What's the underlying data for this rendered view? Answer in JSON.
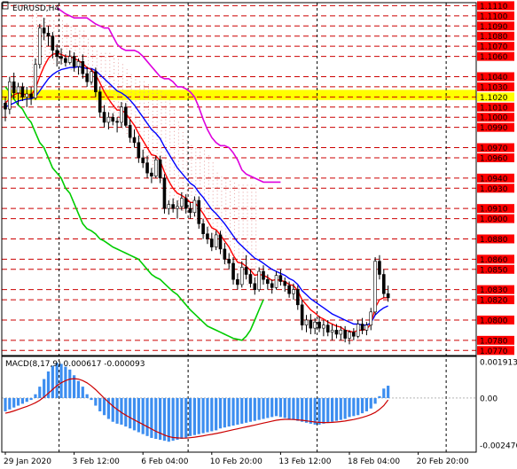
{
  "header": {
    "symbol": "EURUSD,H4",
    "macd_label": "MACD(8,17,9) 0.000617 -0.000093"
  },
  "colors": {
    "candle": "#000000",
    "fast_ma": "#ff0000",
    "slow_ma": "#0000ff",
    "trend_line": "#00cc00",
    "cloud_upper_line": "#dd00dd",
    "hline": "#cc0000",
    "highlight_band": "#ffff00",
    "highlight_tag": "#ffff00",
    "macd_hist": "#3d8ef0",
    "macd_signal": "#cc0000",
    "price_tag": "#ff0000",
    "band_lines": "#00cccc",
    "cloud_dots": "#e8a0a0"
  },
  "chart_data": [
    {
      "type": "candlestick",
      "title": "EURUSD,H4",
      "ylim": [
        1.0765,
        1.1113
      ],
      "price_levels": [
        "1.1110",
        "1.1100",
        "1.1090",
        "1.1080",
        "1.1070",
        "1.1060",
        "1.1040",
        "1.1030",
        "1.1020",
        "1.1010",
        "1.1000",
        "1.0990",
        "1.0970",
        "1.0960",
        "1.0940",
        "1.0930",
        "1.0910",
        "1.0900",
        "1.0880",
        "1.0860",
        "1.0850",
        "1.0830",
        "1.0820",
        "1.0800",
        "1.0780",
        "1.0770"
      ],
      "highlight_levels": [
        "1.1020"
      ],
      "highlight_band": [
        1.1017,
        1.1027
      ],
      "x_labels": [
        "29 Jan 2020",
        "3 Feb 12:00",
        "6 Feb 04:00",
        "10 Feb 20:00",
        "13 Feb 12:00",
        "18 Feb 04:00",
        "20 Feb 20:00"
      ],
      "x_label_index": [
        0,
        16,
        32,
        48,
        64,
        80,
        96
      ],
      "vlines_index": [
        12.5,
        42.5,
        72.5,
        102.5
      ],
      "candles_ohlc": [
        [
          1.1014,
          1.102,
          1.0996,
          1.1008
        ],
        [
          1.1008,
          1.104,
          1.1003,
          1.1035
        ],
        [
          1.1035,
          1.1044,
          1.1018,
          1.1024
        ],
        [
          1.1024,
          1.1034,
          1.1012,
          1.103
        ],
        [
          1.103,
          1.1034,
          1.1016,
          1.102
        ],
        [
          1.102,
          1.103,
          1.101,
          1.1023
        ],
        [
          1.1023,
          1.103,
          1.1012,
          1.1019
        ],
        [
          1.1019,
          1.1058,
          1.1017,
          1.1052
        ],
        [
          1.1052,
          1.1092,
          1.1048,
          1.1088
        ],
        [
          1.1088,
          1.1098,
          1.1076,
          1.1083
        ],
        [
          1.1083,
          1.109,
          1.107,
          1.108
        ],
        [
          1.108,
          1.1084,
          1.1058,
          1.1066
        ],
        [
          1.1066,
          1.1072,
          1.105,
          1.106
        ],
        [
          1.106,
          1.1068,
          1.1052,
          1.1058
        ],
        [
          1.1058,
          1.1062,
          1.105,
          1.1054
        ],
        [
          1.1054,
          1.1066,
          1.1052,
          1.106
        ],
        [
          1.106,
          1.1064,
          1.1045,
          1.105
        ],
        [
          1.105,
          1.1058,
          1.1042,
          1.1055
        ],
        [
          1.1055,
          1.1062,
          1.1038,
          1.1043
        ],
        [
          1.1043,
          1.105,
          1.103,
          1.1035
        ],
        [
          1.1035,
          1.1048,
          1.1032,
          1.1045
        ],
        [
          1.1045,
          1.1049,
          1.102,
          1.1025
        ],
        [
          1.1025,
          1.103,
          1.1,
          1.1005
        ],
        [
          1.1005,
          1.1012,
          1.099,
          1.0995
        ],
        [
          1.0995,
          1.1005,
          1.0988,
          1.1
        ],
        [
          1.1,
          1.1004,
          1.0992,
          1.0996
        ],
        [
          1.0996,
          1.1,
          1.0985,
          1.0995
        ],
        [
          1.0995,
          1.1015,
          1.099,
          1.101
        ],
        [
          1.101,
          1.1014,
          1.099,
          1.0992
        ],
        [
          1.0992,
          1.0998,
          1.0975,
          1.098
        ],
        [
          1.098,
          1.0988,
          1.097,
          1.0975
        ],
        [
          1.0975,
          1.0982,
          1.0955,
          1.096
        ],
        [
          1.096,
          1.0968,
          1.095,
          1.0955
        ],
        [
          1.0955,
          1.0962,
          1.094,
          1.0945
        ],
        [
          1.0945,
          1.095,
          1.0935,
          1.0942
        ],
        [
          1.0942,
          1.0962,
          1.094,
          1.0958
        ],
        [
          1.0958,
          1.0962,
          1.0935,
          1.094
        ],
        [
          1.094,
          1.0944,
          1.0905,
          1.091
        ],
        [
          1.091,
          1.0918,
          1.0904,
          1.0914
        ],
        [
          1.0914,
          1.092,
          1.0906,
          1.091
        ],
        [
          1.091,
          1.0918,
          1.09,
          1.0912
        ],
        [
          1.0912,
          1.0926,
          1.0908,
          1.092
        ],
        [
          1.092,
          1.0924,
          1.0905,
          1.091
        ],
        [
          1.091,
          1.0916,
          1.09,
          1.0906
        ],
        [
          1.0906,
          1.0922,
          1.0902,
          1.0918
        ],
        [
          1.0918,
          1.0922,
          1.089,
          1.0895
        ],
        [
          1.0895,
          1.09,
          1.088,
          1.0885
        ],
        [
          1.0885,
          1.0892,
          1.0875,
          1.088
        ],
        [
          1.088,
          1.0886,
          1.0868,
          1.0872
        ],
        [
          1.0872,
          1.0888,
          1.0869,
          1.0884
        ],
        [
          1.0884,
          1.0888,
          1.0865,
          1.087
        ],
        [
          1.087,
          1.0876,
          1.0855,
          1.086
        ],
        [
          1.086,
          1.0866,
          1.085,
          1.0856
        ],
        [
          1.0856,
          1.0862,
          1.0835,
          1.084
        ],
        [
          1.084,
          1.0846,
          1.083,
          1.0835
        ],
        [
          1.0835,
          1.0858,
          1.0832,
          1.0852
        ],
        [
          1.0852,
          1.0864,
          1.084,
          1.0845
        ],
        [
          1.0845,
          1.085,
          1.0832,
          1.0836
        ],
        [
          1.0836,
          1.0842,
          1.0825,
          1.083
        ],
        [
          1.083,
          1.0852,
          1.0828,
          1.0848
        ],
        [
          1.0848,
          1.0854,
          1.0835,
          1.084
        ],
        [
          1.084,
          1.0845,
          1.083,
          1.0836
        ],
        [
          1.0836,
          1.084,
          1.0826,
          1.0832
        ],
        [
          1.0832,
          1.0848,
          1.083,
          1.0844
        ],
        [
          1.0844,
          1.085,
          1.0834,
          1.0838
        ],
        [
          1.0838,
          1.0842,
          1.0828,
          1.0834
        ],
        [
          1.0834,
          1.0838,
          1.0822,
          1.0826
        ],
        [
          1.0826,
          1.0836,
          1.082,
          1.083
        ],
        [
          1.083,
          1.0834,
          1.081,
          1.0815
        ],
        [
          1.0815,
          1.082,
          1.079,
          1.0795
        ],
        [
          1.0795,
          1.0805,
          1.0788,
          1.08
        ],
        [
          1.08,
          1.0806,
          1.0786,
          1.0792
        ],
        [
          1.0792,
          1.0802,
          1.0786,
          1.0798
        ],
        [
          1.0798,
          1.0804,
          1.0788,
          1.0792
        ],
        [
          1.0792,
          1.08,
          1.0784,
          1.0795
        ],
        [
          1.0795,
          1.08,
          1.0784,
          1.0788
        ],
        [
          1.0788,
          1.0796,
          1.078,
          1.079
        ],
        [
          1.079,
          1.0796,
          1.0782,
          1.0786
        ],
        [
          1.0786,
          1.0794,
          1.078,
          1.079
        ],
        [
          1.079,
          1.0794,
          1.0778,
          1.0782
        ],
        [
          1.0782,
          1.079,
          1.0776,
          1.0788
        ],
        [
          1.0788,
          1.0792,
          1.078,
          1.0784
        ],
        [
          1.0784,
          1.08,
          1.0782,
          1.0796
        ],
        [
          1.0796,
          1.0802,
          1.0786,
          1.079
        ],
        [
          1.079,
          1.0798,
          1.0785,
          1.0795
        ],
        [
          1.0795,
          1.0812,
          1.079,
          1.0808
        ],
        [
          1.0808,
          1.0862,
          1.0805,
          1.0858
        ],
        [
          1.0858,
          1.0864,
          1.084,
          1.0845
        ],
        [
          1.0845,
          1.085,
          1.0822,
          1.0826
        ],
        [
          1.0826,
          1.0834,
          1.0818,
          1.0822
        ]
      ],
      "fast_ma": [
        1.1014,
        1.1018,
        1.1022,
        1.1024,
        1.1023,
        1.1022,
        1.1022,
        1.1028,
        1.104,
        1.105,
        1.1058,
        1.1062,
        1.1063,
        1.1062,
        1.106,
        1.106,
        1.1058,
        1.1056,
        1.1053,
        1.1049,
        1.1047,
        1.1042,
        1.1034,
        1.1025,
        1.1018,
        1.1012,
        1.1007,
        1.1007,
        1.1004,
        1.0998,
        1.0992,
        1.0984,
        1.0977,
        1.097,
        1.0963,
        1.0962,
        1.0957,
        1.0946,
        1.0937,
        1.093,
        1.0925,
        1.0923,
        1.092,
        1.0916,
        1.0916,
        1.0911,
        1.0905,
        1.0898,
        1.0891,
        1.0889,
        1.0884,
        1.0878,
        1.0872,
        1.0864,
        1.0857,
        1.0856,
        1.0853,
        1.0849,
        1.0844,
        1.0845,
        1.0844,
        1.0842,
        1.0839,
        1.084,
        1.0839,
        1.0838,
        1.0835,
        1.0834,
        1.0829,
        1.082,
        1.0815,
        1.081,
        1.0807,
        1.0803,
        1.0801,
        1.0798,
        1.0796,
        1.0794,
        1.0793,
        1.079,
        1.0789,
        1.0788,
        1.079,
        1.079,
        1.0791,
        1.0796,
        1.0812,
        1.082,
        1.0822,
        1.0822
      ],
      "slow_ma": [
        1.101,
        1.1012,
        1.1014,
        1.1016,
        1.1017,
        1.1018,
        1.1018,
        1.102,
        1.1026,
        1.1032,
        1.1038,
        1.1042,
        1.1045,
        1.1047,
        1.1048,
        1.1049,
        1.1049,
        1.105,
        1.1049,
        1.1048,
        1.1048,
        1.1046,
        1.1042,
        1.1038,
        1.1034,
        1.103,
        1.1026,
        1.1024,
        1.1021,
        1.1017,
        1.1012,
        1.1006,
        1.1,
        1.0994,
        1.0988,
        1.0984,
        1.0979,
        1.0971,
        1.0964,
        1.0957,
        1.095,
        1.0945,
        1.094,
        1.0935,
        1.0932,
        1.0926,
        1.0921,
        1.0915,
        1.0909,
        1.0905,
        1.09,
        1.0895,
        1.0889,
        1.0883,
        1.0877,
        1.0873,
        1.0869,
        1.0865,
        1.0861,
        1.0859,
        1.0856,
        1.0853,
        1.085,
        1.0848,
        1.0846,
        1.0844,
        1.0841,
        1.0839,
        1.0835,
        1.0829,
        1.0825,
        1.0821,
        1.0818,
        1.0815,
        1.0812,
        1.0809,
        1.0806,
        1.0804,
        1.0802,
        1.08,
        1.0798,
        1.0796,
        1.0796,
        1.0795,
        1.0795,
        1.0797,
        1.0805,
        1.0809,
        1.0812,
        1.0814
      ],
      "trend_line": [
        1.103,
        1.1025,
        1.1018,
        1.1012,
        1.1008,
        1.1,
        1.0995,
        1.0985,
        1.0975,
        1.097,
        1.096,
        1.095,
        1.0945,
        1.094,
        1.093,
        1.0925,
        1.0915,
        1.0905,
        1.0895,
        1.089,
        1.0888,
        1.0885,
        1.088,
        1.0878,
        1.0875,
        1.0872,
        1.087,
        1.0868,
        1.0866,
        1.0864,
        1.0862,
        1.086,
        1.0855,
        1.085,
        1.0845,
        1.0842,
        1.084,
        1.0836,
        1.0832,
        1.0828,
        1.0825,
        1.082,
        1.0815,
        1.081,
        1.0806,
        1.0802,
        1.0798,
        1.0794,
        1.0792,
        1.079,
        1.0788,
        1.0786,
        1.0784,
        1.0782,
        1.0781,
        1.078,
        1.0784,
        1.079,
        1.08,
        1.081,
        1.082
      ],
      "cloud_upper": [
        1.1108,
        1.1105,
        1.1102,
        1.11,
        1.1098,
        1.1098,
        1.1098,
        1.1098,
        1.1095,
        1.1092,
        1.109,
        1.1088,
        1.1088,
        1.108,
        1.1072,
        1.1068,
        1.1066,
        1.1066,
        1.1066,
        1.1064,
        1.106,
        1.1055,
        1.105,
        1.1045,
        1.104,
        1.1038,
        1.1038,
        1.1035,
        1.103,
        1.103,
        1.1028,
        1.1025,
        1.102,
        1.101,
        1.0998,
        1.0988,
        1.098,
        1.0975,
        1.0972,
        1.0972,
        1.097,
        1.0965,
        1.0958,
        1.0948,
        1.0944,
        1.0942,
        1.094,
        1.0938,
        1.0936,
        1.0936,
        1.0936,
        1.0936,
        1.0936
      ],
      "macd": {
        "ylim": [
          -0.002476,
          0.001913
        ],
        "tick_labels": [
          "0.001913",
          "0.00",
          "-0.002476"
        ],
        "hist": [
          -0.0007,
          -0.0006,
          -0.0005,
          -0.0004,
          -0.0003,
          -0.0002,
          -0.0001,
          0.0002,
          0.0006,
          0.001,
          0.0014,
          0.0017,
          0.00185,
          0.0018,
          0.00165,
          0.0015,
          0.0012,
          0.0009,
          0.0006,
          0.0002,
          -0.0001,
          -0.0004,
          -0.0007,
          -0.0009,
          -0.0011,
          -0.00125,
          -0.00135,
          -0.0014,
          -0.0015,
          -0.0016,
          -0.0017,
          -0.0018,
          -0.0019,
          -0.002,
          -0.0021,
          -0.00215,
          -0.0022,
          -0.00225,
          -0.0023,
          -0.00225,
          -0.0022,
          -0.00215,
          -0.0021,
          -0.002,
          -0.00195,
          -0.0019,
          -0.00185,
          -0.0018,
          -0.00175,
          -0.0017,
          -0.0016,
          -0.00155,
          -0.0015,
          -0.00145,
          -0.0014,
          -0.00135,
          -0.0013,
          -0.00125,
          -0.0012,
          -0.00115,
          -0.0011,
          -0.00105,
          -0.001,
          -0.00095,
          -0.001,
          -0.00105,
          -0.0011,
          -0.00115,
          -0.0012,
          -0.00125,
          -0.0013,
          -0.00135,
          -0.0014,
          -0.0014,
          -0.00135,
          -0.0013,
          -0.00125,
          -0.0012,
          -0.00115,
          -0.0011,
          -0.001,
          -0.00095,
          -0.0009,
          -0.0008,
          -0.0007,
          -0.00055,
          -0.0003,
          0.0001,
          0.0005,
          0.00065
        ],
        "signal": [
          -0.0008,
          -0.00075,
          -0.00068,
          -0.0006,
          -0.00052,
          -0.00044,
          -0.00035,
          -0.00025,
          -0.00012,
          5e-05,
          0.00025,
          0.00045,
          0.00065,
          0.0008,
          0.00092,
          0.001,
          0.00102,
          0.001,
          0.00092,
          0.0008,
          0.00064,
          0.00044,
          0.00022,
          0.0,
          -0.00022,
          -0.00042,
          -0.0006,
          -0.00076,
          -0.0009,
          -0.00103,
          -0.00115,
          -0.00127,
          -0.00139,
          -0.00151,
          -0.00163,
          -0.00175,
          -0.00185,
          -0.00195,
          -0.00203,
          -0.00208,
          -0.0021,
          -0.00211,
          -0.00211,
          -0.00209,
          -0.00206,
          -0.00203,
          -0.00199,
          -0.00195,
          -0.00191,
          -0.00187,
          -0.00182,
          -0.00177,
          -0.00172,
          -0.00167,
          -0.00162,
          -0.00157,
          -0.00152,
          -0.00147,
          -0.00142,
          -0.00137,
          -0.00132,
          -0.00127,
          -0.00122,
          -0.00117,
          -0.00114,
          -0.00112,
          -0.00112,
          -0.00113,
          -0.00115,
          -0.00117,
          -0.0012,
          -0.00123,
          -0.00126,
          -0.00128,
          -0.00129,
          -0.00129,
          -0.00128,
          -0.00126,
          -0.00124,
          -0.00121,
          -0.00117,
          -0.00113,
          -0.00108,
          -0.00102,
          -0.00095,
          -0.00087,
          -0.00076,
          -0.0006,
          -0.0004,
          -0.0001
        ]
      }
    }
  ]
}
